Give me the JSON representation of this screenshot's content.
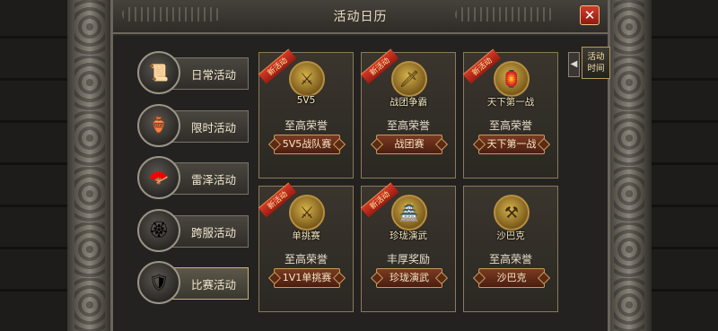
{
  "window": {
    "title": "活动日历",
    "close_label": "✕"
  },
  "sidebar": {
    "items": [
      {
        "label": "日常活动",
        "glyph": "📜",
        "active": false
      },
      {
        "label": "限时活动",
        "glyph": "🏺",
        "active": false
      },
      {
        "label": "雷泽活动",
        "glyph": "🪭",
        "active": false
      },
      {
        "label": "跨服活动",
        "glyph": "🏵",
        "active": false
      },
      {
        "label": "比赛活动",
        "glyph": "🛡",
        "active": true
      }
    ]
  },
  "panel": {
    "expand_arrow": "◀",
    "time_tab_label": "活动时间"
  },
  "events": [
    {
      "badge": "新活动",
      "icon_label": "5V5",
      "glyph": "⚔",
      "reward": "至高荣誉",
      "button": "5V5战队赛"
    },
    {
      "badge": "新活动",
      "icon_label": "战团争霸",
      "glyph": "🗡",
      "reward": "至高荣誉",
      "button": "战团赛"
    },
    {
      "badge": "新活动",
      "icon_label": "天下第一战",
      "glyph": "🏮",
      "reward": "至高荣誉",
      "button": "天下第一战"
    },
    {
      "badge": "新活动",
      "icon_label": "单挑赛",
      "glyph": "⚔",
      "reward": "至高荣誉",
      "button": "1V1单挑赛"
    },
    {
      "badge": "新活动",
      "icon_label": "珍珑演武",
      "glyph": "🏯",
      "reward": "丰厚奖励",
      "button": "珍珑演武"
    },
    {
      "badge": "",
      "icon_label": "沙巴克",
      "glyph": "⚒",
      "reward": "至高荣誉",
      "button": "沙巴克"
    }
  ]
}
